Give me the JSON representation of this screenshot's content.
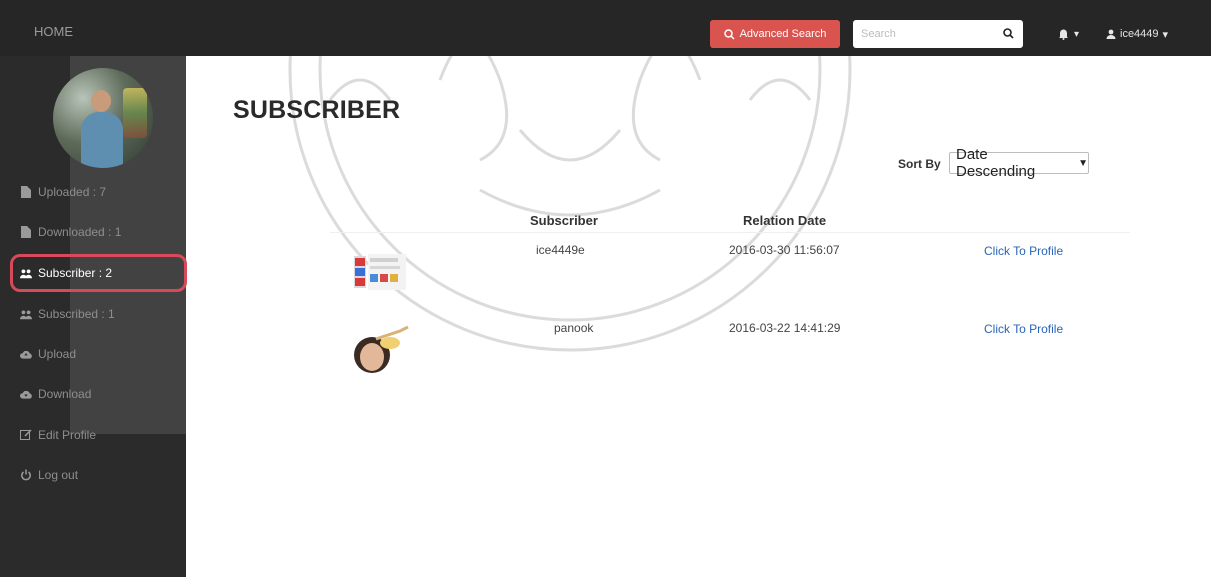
{
  "navbar": {
    "brand": "HOME",
    "advanced_search": "Advanced Search",
    "search_placeholder": "Search",
    "username": "ice4449"
  },
  "sidebar": {
    "items": [
      {
        "label": "Uploaded : 7",
        "icon": "file-icon"
      },
      {
        "label": "Downloaded : 1",
        "icon": "file-icon"
      },
      {
        "label": "Subscriber : 2",
        "icon": "users-icon",
        "active": true
      },
      {
        "label": "Subscribed : 1",
        "icon": "users-icon"
      },
      {
        "label": "Upload",
        "icon": "cloud-upload-icon"
      },
      {
        "label": "Download",
        "icon": "cloud-download-icon"
      },
      {
        "label": "Edit Profile",
        "icon": "edit-icon"
      },
      {
        "label": "Log out",
        "icon": "power-icon"
      }
    ]
  },
  "page": {
    "title": "SUBSCRIBER",
    "sort_label": "Sort By",
    "sort_selected": "Date Descending"
  },
  "table": {
    "headers": {
      "subscriber": "Subscriber",
      "relation_date": "Relation Date"
    },
    "rows": [
      {
        "subscriber": "ice4449e",
        "relation_date": "2016-03-30 11:56:07",
        "action": "Click To Profile"
      },
      {
        "subscriber": "panook",
        "relation_date": "2016-03-22 14:41:29",
        "action": "Click To Profile"
      }
    ]
  },
  "colors": {
    "navbar_bg": "#262626",
    "sidebar_bg": "#2b2b2b",
    "advanced_search_bg": "#d9534f",
    "highlight_border": "#d64a5a",
    "link": "#2a64b8"
  }
}
